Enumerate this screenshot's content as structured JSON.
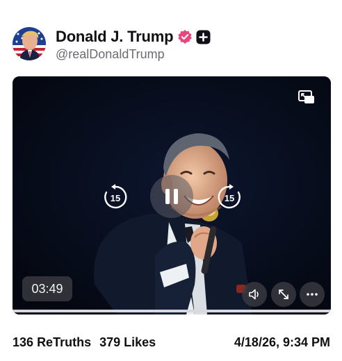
{
  "post": {
    "author": {
      "display_name": "Donald J. Trump",
      "handle": "@realDonaldTrump",
      "verified_color": "#e8467c"
    },
    "video": {
      "elapsed_time": "03:49",
      "skip_back_seconds": "15",
      "skip_forward_seconds": "15",
      "state": "playing"
    },
    "stats": {
      "retruths_count": "136",
      "retruths_label": "ReTruths",
      "likes_count": "379",
      "likes_label": "Likes"
    },
    "timestamp": "4/18/26, 9:34 PM"
  },
  "icons": {
    "verified": "verified-check-icon",
    "plus": "plus-badge-icon",
    "pip": "picture-in-picture-icon",
    "skip_back": "rewind-15-icon",
    "pause": "pause-icon",
    "skip_forward": "forward-15-icon",
    "mute": "speaker-icon",
    "expand": "expand-icon",
    "more": "more-dots-icon"
  }
}
